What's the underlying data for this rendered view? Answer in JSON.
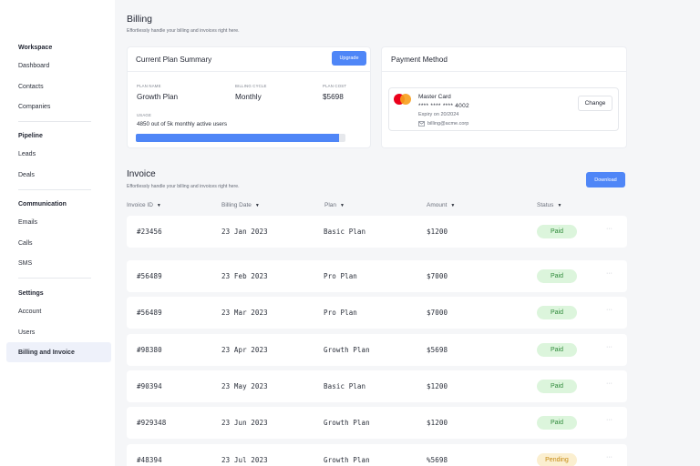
{
  "sidebar": {
    "groups": [
      {
        "title": "Workspace",
        "items": [
          "Dashboard",
          "Contacts",
          "Companies"
        ]
      },
      {
        "title": "Pipeline",
        "items": [
          "Leads",
          "Deals"
        ]
      },
      {
        "title": "Communication",
        "items": [
          "Emails",
          "Calls",
          "SMS"
        ]
      },
      {
        "title": "Settings",
        "items": [
          "Account",
          "Users",
          "Billing and Invoice"
        ]
      }
    ],
    "active_item": "Billing and Invoice"
  },
  "billing": {
    "title": "Billing",
    "subtitle": "Effortlessly handle your billing and invoices right here."
  },
  "plan_summary": {
    "title": "Current Plan Summary",
    "upgrade_label": "Upgrade",
    "plan_name_label": "PLAN NAME",
    "plan_name": "Growth Plan",
    "billing_cycle_label": "BILLING CYCLE",
    "billing_cycle": "Monthly",
    "plan_cost_label": "PLAN COST",
    "plan_cost": "$5698",
    "usage_label": "USAGE",
    "usage_text": "4850 out of 5k monthly active users",
    "usage_fraction": 0.97
  },
  "payment_method": {
    "title": "Payment Method",
    "card_name": "Master Card",
    "card_number": "**** **** **** 4002",
    "expiry": "Expiry on 20/2024",
    "email": "billing@acme.corp",
    "change_label": "Change"
  },
  "invoice": {
    "title": "Invoice",
    "subtitle": "Effortlessly handle your billing and invoices right here.",
    "download_label": "Download",
    "columns": [
      "Invoice ID",
      "Billing Date",
      "Plan",
      "Amount",
      "Status"
    ],
    "rows": [
      {
        "id": "#23456",
        "date": "23 Jan 2023",
        "plan": "Basic Plan",
        "amount": "$1200",
        "status": "Paid"
      },
      {
        "id": "#56489",
        "date": "23 Feb 2023",
        "plan": "Pro Plan",
        "amount": "$7000",
        "status": "Paid"
      },
      {
        "id": "#56489",
        "date": "23 Mar 2023",
        "plan": "Pro Plan",
        "amount": "$7000",
        "status": "Paid"
      },
      {
        "id": "#98380",
        "date": "23 Apr 2023",
        "plan": "Growth Plan",
        "amount": "$5698",
        "status": "Paid"
      },
      {
        "id": "#90394",
        "date": "23 May 2023",
        "plan": "Basic Plan",
        "amount": "$1200",
        "status": "Paid"
      },
      {
        "id": "#929348",
        "date": "23 Jun 2023",
        "plan": "Growth Plan",
        "amount": "$1200",
        "status": "Paid"
      },
      {
        "id": "#48394",
        "date": "23 Jul 2023",
        "plan": "Growth Plan",
        "amount": "%5698",
        "status": "Pending"
      }
    ]
  },
  "colors": {
    "accent": "#4f86f7",
    "paid_bg": "#dcf5dc",
    "paid_text": "#2f8a3a",
    "pending_bg": "#fbefd0",
    "pending_text": "#c78a12"
  },
  "icons": {
    "card_brand": "mastercard-icon",
    "email": "mail-icon",
    "sort": "caret-down-icon",
    "row_menu": "more-horizontal-icon"
  }
}
